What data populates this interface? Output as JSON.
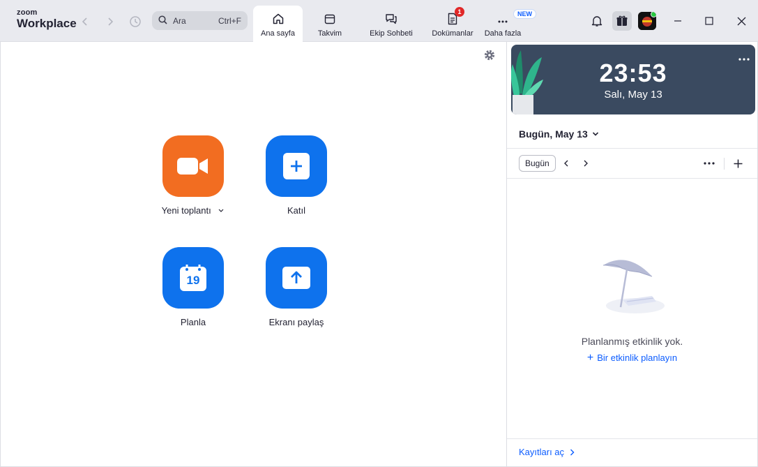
{
  "app": {
    "logo_top": "zoom",
    "logo_bottom": "Workplace"
  },
  "search": {
    "placeholder": "Ara",
    "shortcut": "Ctrl+F"
  },
  "tabs": [
    {
      "label": "Ana sayfa",
      "icon": "home-icon",
      "active": true
    },
    {
      "label": "Takvim",
      "icon": "calendar-icon"
    },
    {
      "label": "Ekip Sohbeti",
      "icon": "chat-icon"
    },
    {
      "label": "Dokümanlar",
      "icon": "docs-icon",
      "badge": "1"
    },
    {
      "label": "Daha fazla",
      "icon": "more-apps-icon",
      "badge": "NEW"
    }
  ],
  "actions": [
    {
      "label": "Yeni toplantı",
      "icon": "video-camera-icon",
      "color": "#f26d21"
    },
    {
      "label": "Katıl",
      "icon": "plus-icon",
      "color": "#0e72ed"
    },
    {
      "label": "Planla",
      "icon": "calendar-19-icon",
      "color": "#0e72ed",
      "icon_text": "19"
    },
    {
      "label": "Ekranı paylaş",
      "icon": "share-screen-icon",
      "color": "#0e72ed"
    }
  ],
  "clock": {
    "time": "23:53",
    "date": "Salı, May 13"
  },
  "calendar": {
    "day_selector": "Bugün, May 13",
    "today_button": "Bugün",
    "empty_text": "Planlanmış etkinlik yok.",
    "schedule_link": "Bir etkinlik planlayın"
  },
  "footer": {
    "recordings_link": "Kayıtları aç"
  },
  "colors": {
    "accent_blue": "#0e72ed",
    "accent_orange": "#f26d21",
    "link": "#0b5cff",
    "badge_red": "#e02828"
  }
}
